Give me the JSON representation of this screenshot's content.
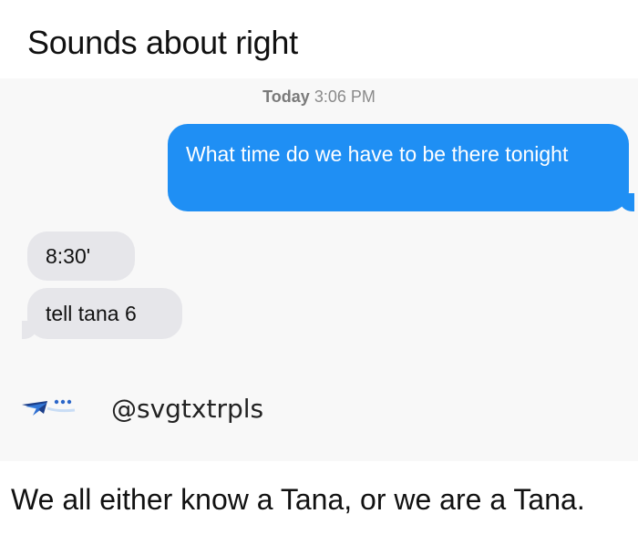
{
  "post": {
    "title": "Sounds about right",
    "caption": "We all either know a Tana, or we are a Tana."
  },
  "conversation": {
    "timestamp_day": "Today",
    "timestamp_time": "3:06 PM",
    "messages": [
      {
        "direction": "outgoing",
        "text": "What time do we have to be there tonight"
      },
      {
        "direction": "incoming",
        "text": "8:30'"
      },
      {
        "direction": "incoming",
        "text": "tell tana 6"
      }
    ]
  },
  "credit": {
    "icon": "airplane-sender-icon",
    "handle": "@svgtxtrpls"
  },
  "colors": {
    "outgoing_bubble": "#1f8ff4",
    "incoming_bubble": "#e6e6ea"
  }
}
